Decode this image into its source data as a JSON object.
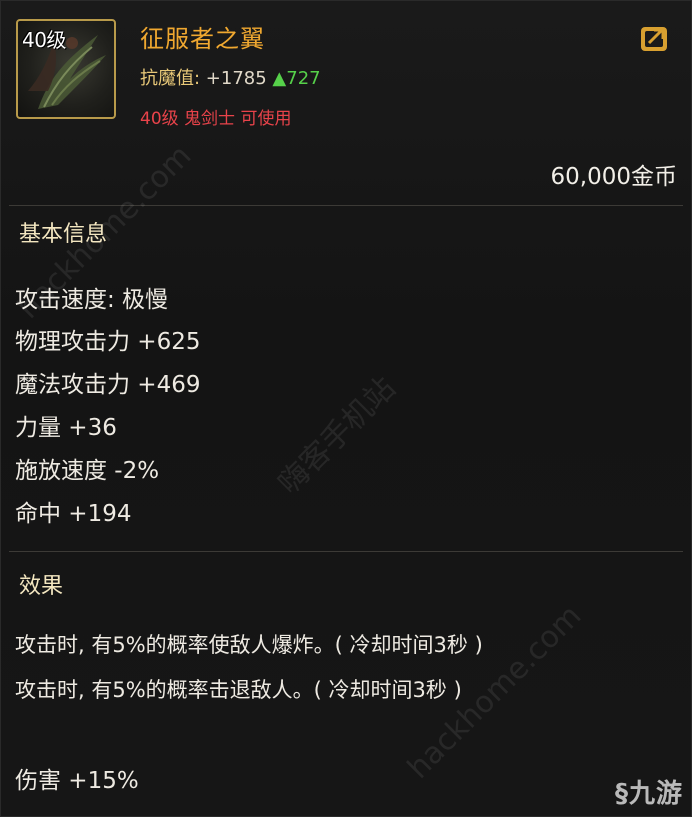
{
  "item": {
    "level_badge": "40级",
    "name": "征服者之翼",
    "stat_label": "抗魔值:",
    "stat_value": " +1785 ",
    "stat_delta": "▲727",
    "requirement": "40级 鬼剑士 可使用",
    "price": "60,000金币",
    "icon": "wing-equipment-icon",
    "share_icon": "share-export-icon"
  },
  "basic_info": {
    "title": "基本信息",
    "attributes": [
      "攻击速度: 极慢",
      "物理攻击力 +625",
      "魔法攻击力 +469",
      "力量 +36",
      "施放速度 -2%",
      "命中 +194"
    ]
  },
  "effect": {
    "title": "效果",
    "lines": [
      "攻击时, 有5%的概率使敌人爆炸。( 冷却时间3秒 )",
      "攻击时, 有5%的概率击退敌人。( 冷却时间3秒 )"
    ],
    "bonus": "伤害 +15%"
  },
  "watermarks": {
    "site_1": "hackhome.com",
    "site_2": "嗨客手机站",
    "site_3": "hackhome.com"
  },
  "corner_logo": "九游",
  "colors": {
    "item_name": "#f0a830",
    "requirement": "#e8434a",
    "delta_up": "#56d14a",
    "icon_border": "#b89a4a"
  }
}
